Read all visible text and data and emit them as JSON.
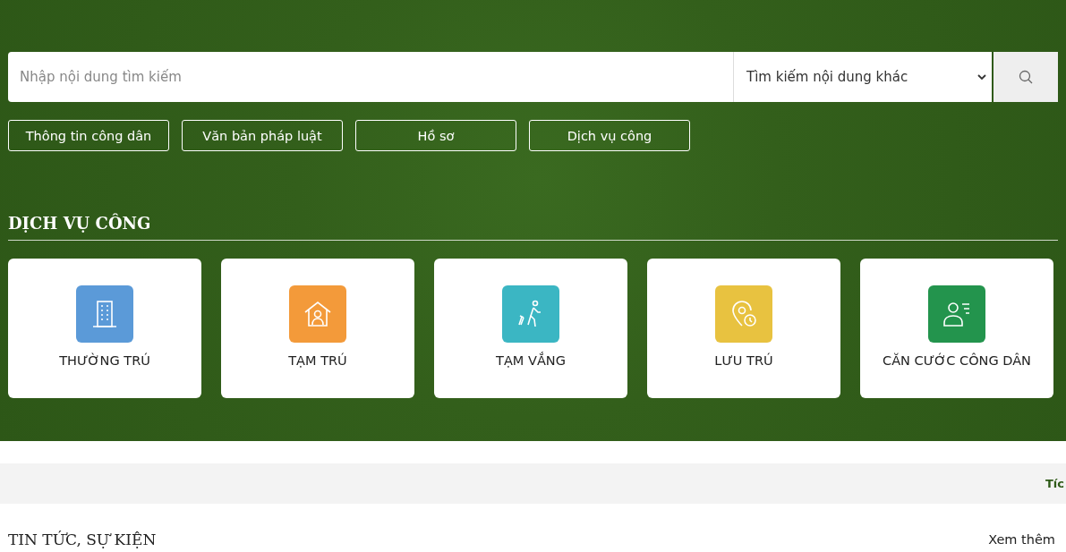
{
  "search": {
    "placeholder": "Nhập nội dung tìm kiếm",
    "scope": "Tìm kiếm nội dung khác"
  },
  "quick_links": [
    "Thông tin công dân",
    "Văn bản pháp luật",
    "Hồ sơ",
    "Dịch vụ công"
  ],
  "services": {
    "heading": "DỊCH VỤ CÔNG",
    "items": [
      {
        "label": "THƯỜNG TRÚ",
        "kind": "building",
        "color": "#5b9ad8"
      },
      {
        "label": "TẠM TRÚ",
        "kind": "house",
        "color": "#f39a3a"
      },
      {
        "label": "TẠM VẮNG",
        "kind": "traveler",
        "color": "#3bb6c3"
      },
      {
        "label": "LƯU TRÚ",
        "kind": "pin",
        "color": "#e8c240"
      },
      {
        "label": "CĂN CƯỚC CÔNG DÂN",
        "kind": "idcard",
        "color": "#23944d"
      }
    ]
  },
  "ticker": "Tíc",
  "news": {
    "heading": "TIN TỨC, SỰ KIỆN",
    "more": "Xem thêm"
  }
}
